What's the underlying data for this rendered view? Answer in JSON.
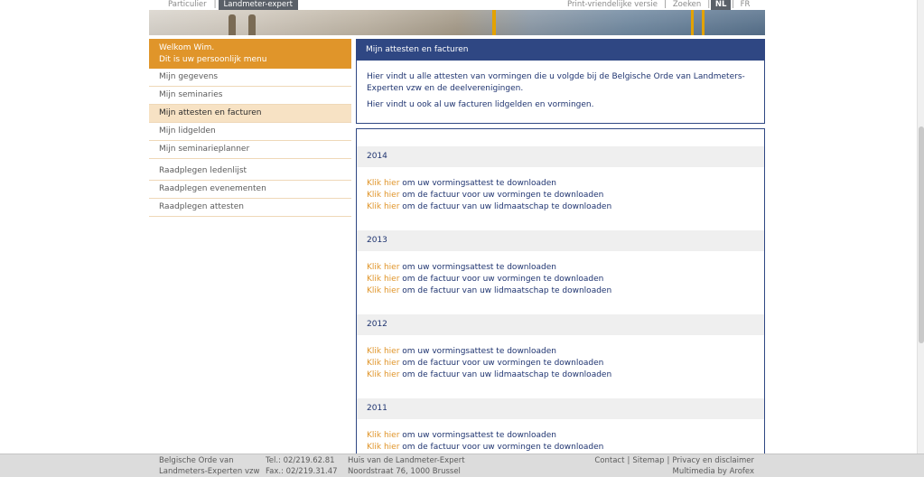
{
  "topnav": {
    "tabs": [
      "Particulier",
      "Landmeter-expert"
    ],
    "active_tab": "Landmeter-expert",
    "print_label": "Print-vriendelijke versie",
    "search_label": "Zoeken",
    "languages": [
      "NL",
      "FR"
    ],
    "active_language": "NL"
  },
  "sidebar": {
    "welcome_line1": "Welkom Wim.",
    "welcome_line2": "Dit is uw persoonlijk menu",
    "items": [
      {
        "label": "Mijn gegevens"
      },
      {
        "label": "Mijn seminaries"
      },
      {
        "label": "Mijn attesten en facturen",
        "active": true
      },
      {
        "label": "Mijn lidgelden"
      },
      {
        "label": "Mijn seminarieplanner"
      },
      {
        "label": "Raadplegen ledenlijst"
      },
      {
        "label": "Raadplegen evenementen"
      },
      {
        "label": "Raadplegen attesten"
      }
    ]
  },
  "main": {
    "title": "Mijn attesten en facturen",
    "intro_p1": "Hier vindt u alle attesten van vormingen die u volgde bij de Belgische Orde van Landmeters-Experten vzw en de deelverenigingen.",
    "intro_p2": "Hier vindt u ook al uw facturen lidgelden en vormingen.",
    "link_prefix": "Klik hier",
    "link_texts": [
      "om uw vormingsattest te downloaden",
      "om de factuur voor uw vormingen te downloaden",
      "om de factuur van uw lidmaatschap te downloaden"
    ],
    "years": [
      {
        "year": "2014"
      },
      {
        "year": "2013"
      },
      {
        "year": "2012"
      },
      {
        "year": "2011"
      }
    ]
  },
  "footer": {
    "org_line1": "Belgische Orde van",
    "org_line2": "Landmeters-Experten vzw",
    "tel": "Tel.: 02/219.62.81",
    "fax": "Fax.: 02/219.31.47",
    "house": "Huis van de Landmeter-Expert",
    "address": "Noordstraat 76, 1000 Brussel",
    "contact": "Contact",
    "sitemap": "Sitemap",
    "privacy": "Privacy en disclaimer",
    "credit": "Multimedia by Arofex"
  },
  "colors": {
    "accent_orange": "#e0952a",
    "navy": "#2f4783",
    "text_navy": "#1f3470"
  }
}
